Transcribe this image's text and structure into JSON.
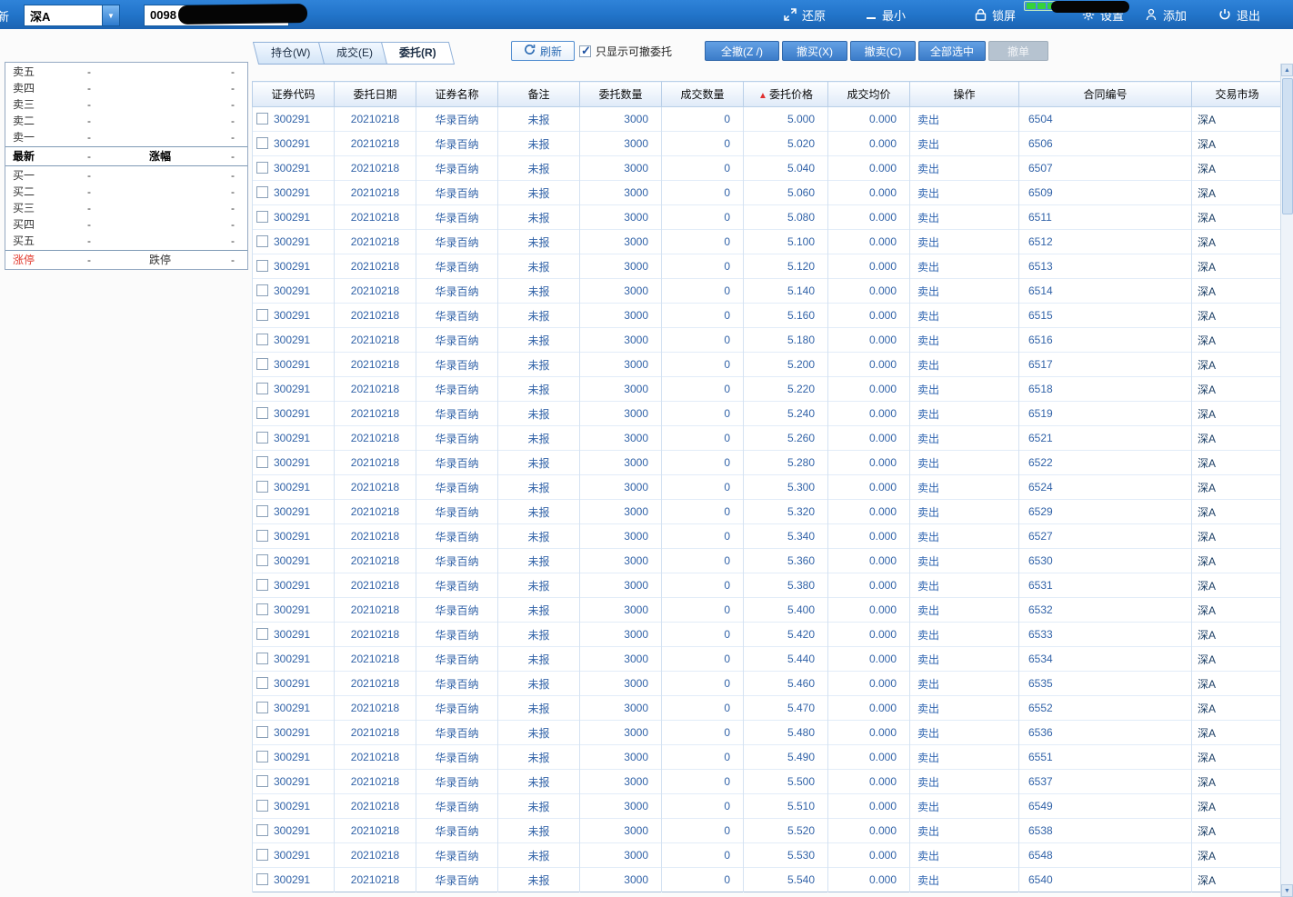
{
  "titlebar": {
    "partial_text": "新",
    "market_select": "深A",
    "account_value": "0098",
    "buttons": [
      {
        "label": "还原",
        "icon": "restore-icon"
      },
      {
        "label": "最小",
        "icon": "minimize-icon"
      },
      {
        "label": "锁屏",
        "icon": "lock-icon"
      },
      {
        "label": "设置",
        "icon": "gear-icon"
      },
      {
        "label": "添加",
        "icon": "add-user-icon"
      },
      {
        "label": "退出",
        "icon": "power-icon"
      }
    ]
  },
  "quote_panel": {
    "sells": [
      {
        "label": "卖五",
        "price": "-",
        "volume": "-"
      },
      {
        "label": "卖四",
        "price": "-",
        "volume": "-"
      },
      {
        "label": "卖三",
        "price": "-",
        "volume": "-"
      },
      {
        "label": "卖二",
        "price": "-",
        "volume": "-"
      },
      {
        "label": "卖一",
        "price": "-",
        "volume": "-"
      }
    ],
    "latest": {
      "label": "最新",
      "value": "-",
      "change_label": "涨幅",
      "change_value": "-"
    },
    "buys": [
      {
        "label": "买一",
        "price": "-",
        "volume": "-"
      },
      {
        "label": "买二",
        "price": "-",
        "volume": "-"
      },
      {
        "label": "买三",
        "price": "-",
        "volume": "-"
      },
      {
        "label": "买四",
        "price": "-",
        "volume": "-"
      },
      {
        "label": "买五",
        "price": "-",
        "volume": "-"
      }
    ],
    "limits": {
      "up_label": "涨停",
      "up_value": "-",
      "down_label": "跌停",
      "down_value": "-"
    }
  },
  "toolbar": {
    "tabs": [
      {
        "label": "持仓(W)",
        "active": false
      },
      {
        "label": "成交(E)",
        "active": false
      },
      {
        "label": "委托(R)",
        "active": true
      }
    ],
    "refresh_label": "刷新",
    "checkbox_label": "只显示可撤委托",
    "checkbox_checked": true,
    "buttons": [
      {
        "label": "全撤(Z /)",
        "enabled": true
      },
      {
        "label": "撤买(X)",
        "enabled": true
      },
      {
        "label": "撤卖(C)",
        "enabled": true
      },
      {
        "label": "全部选中",
        "enabled": true
      },
      {
        "label": "撤单",
        "enabled": false
      }
    ]
  },
  "table": {
    "columns": [
      "证券代码",
      "委托日期",
      "证券名称",
      "备注",
      "委托数量",
      "成交数量",
      "委托价格",
      "成交均价",
      "操作",
      "合同编号",
      "交易市场"
    ],
    "price_sort_arrow": "▲",
    "row_template": {
      "code": "300291",
      "date": "20210218",
      "name": "华录百纳",
      "remark": "未报",
      "qty": "3000",
      "filled": "0",
      "avg": "0.000",
      "action": "卖出",
      "market": "深A"
    },
    "rows": [
      {
        "price": "5.000",
        "contract": "6504"
      },
      {
        "price": "5.020",
        "contract": "6506"
      },
      {
        "price": "5.040",
        "contract": "6507"
      },
      {
        "price": "5.060",
        "contract": "6509"
      },
      {
        "price": "5.080",
        "contract": "6511"
      },
      {
        "price": "5.100",
        "contract": "6512"
      },
      {
        "price": "5.120",
        "contract": "6513"
      },
      {
        "price": "5.140",
        "contract": "6514"
      },
      {
        "price": "5.160",
        "contract": "6515"
      },
      {
        "price": "5.180",
        "contract": "6516"
      },
      {
        "price": "5.200",
        "contract": "6517"
      },
      {
        "price": "5.220",
        "contract": "6518"
      },
      {
        "price": "5.240",
        "contract": "6519"
      },
      {
        "price": "5.260",
        "contract": "6521"
      },
      {
        "price": "5.280",
        "contract": "6522"
      },
      {
        "price": "5.300",
        "contract": "6524"
      },
      {
        "price": "5.320",
        "contract": "6529"
      },
      {
        "price": "5.340",
        "contract": "6527"
      },
      {
        "price": "5.360",
        "contract": "6530"
      },
      {
        "price": "5.380",
        "contract": "6531"
      },
      {
        "price": "5.400",
        "contract": "6532"
      },
      {
        "price": "5.420",
        "contract": "6533"
      },
      {
        "price": "5.440",
        "contract": "6534"
      },
      {
        "price": "5.460",
        "contract": "6535"
      },
      {
        "price": "5.470",
        "contract": "6552"
      },
      {
        "price": "5.480",
        "contract": "6536"
      },
      {
        "price": "5.490",
        "contract": "6551"
      },
      {
        "price": "5.500",
        "contract": "6537"
      },
      {
        "price": "5.510",
        "contract": "6549"
      },
      {
        "price": "5.520",
        "contract": "6538"
      },
      {
        "price": "5.530",
        "contract": "6548"
      },
      {
        "price": "5.540",
        "contract": "6540"
      }
    ]
  },
  "colors": {
    "titlebar_blue": "#2173c8",
    "button_blue": "#3b7cc9",
    "table_text_blue": "#3263a8",
    "limit_up_red": "#e23a2e",
    "battery_green": "#35d23a"
  }
}
